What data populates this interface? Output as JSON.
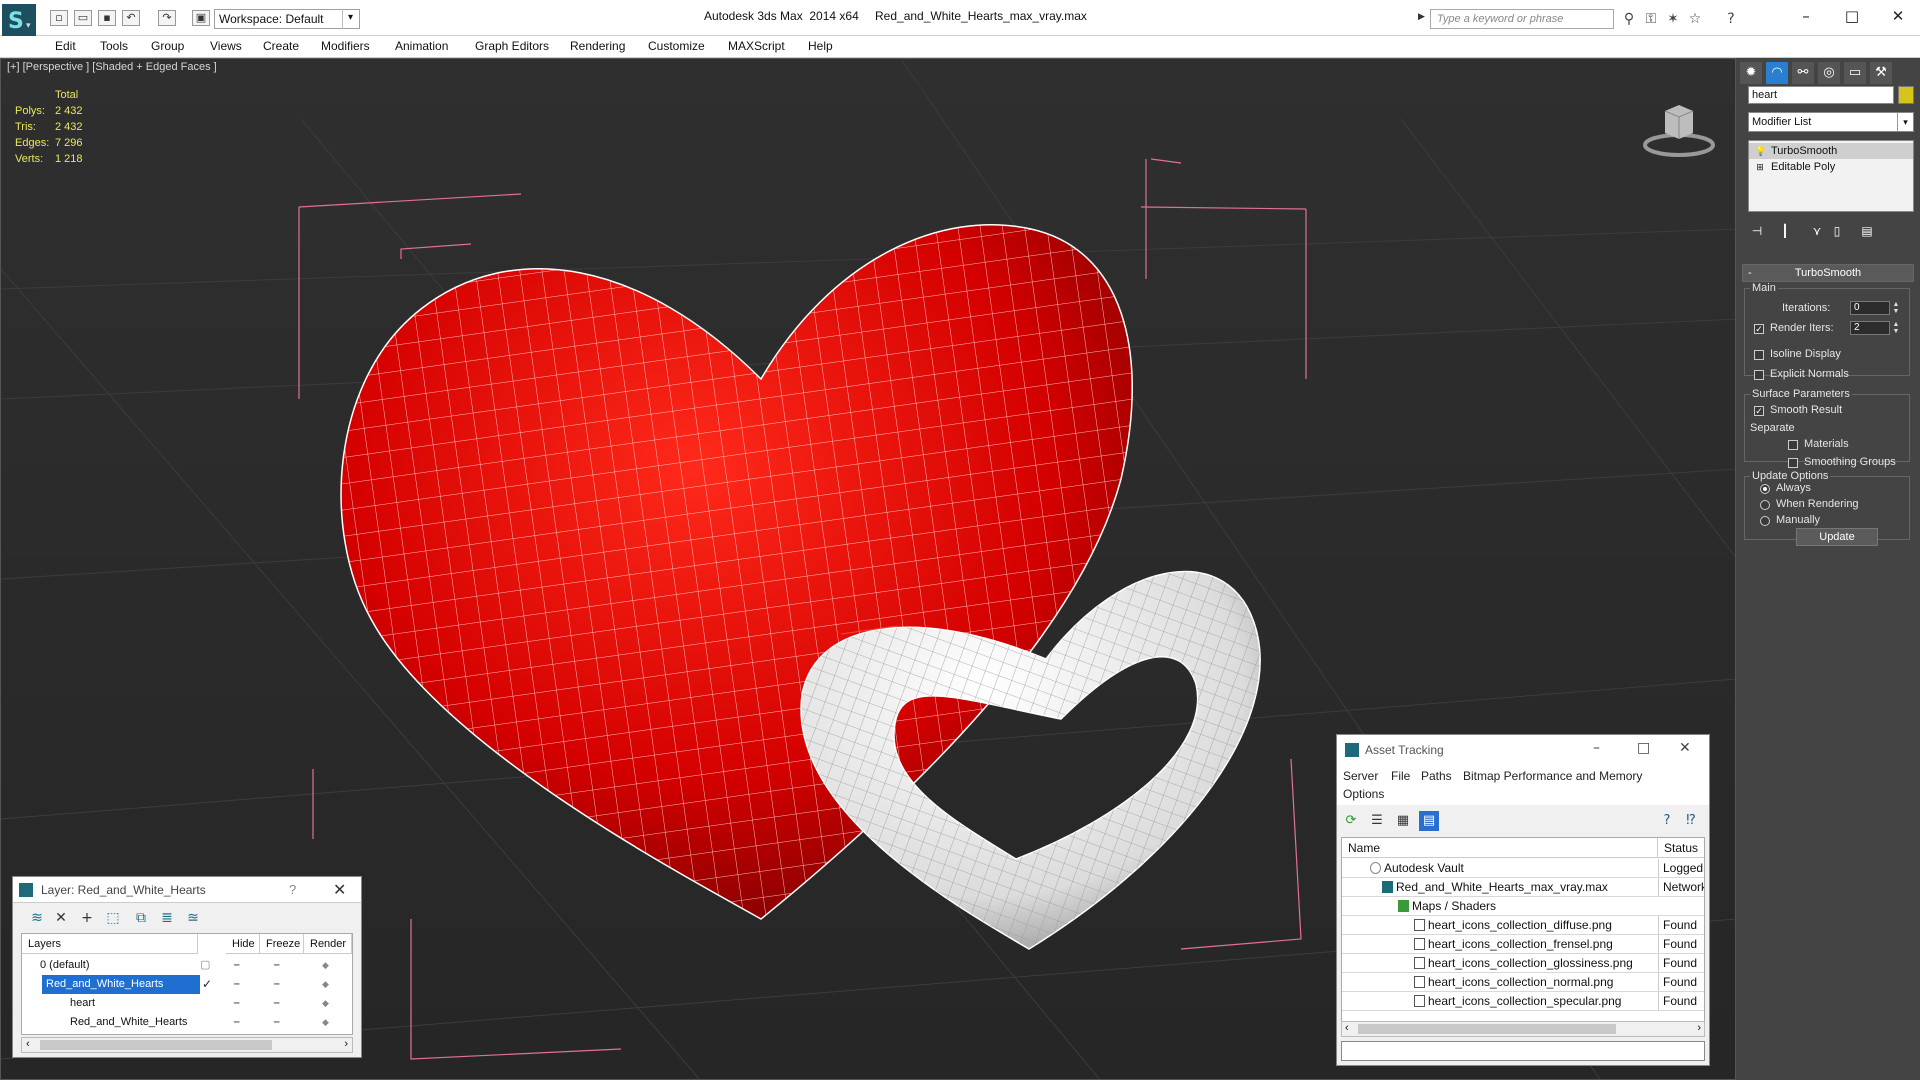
{
  "title_bar": {
    "app_title": "Autodesk 3ds Max  2014 x64",
    "file_title": "Red_and_White_Hearts_max_vray.max",
    "workspace": "Workspace: Default",
    "search_placeholder": "Type a keyword or phrase"
  },
  "menu": [
    "Edit",
    "Tools",
    "Group",
    "Views",
    "Create",
    "Modifiers",
    "Animation",
    "Graph Editors",
    "Rendering",
    "Customize",
    "MAXScript",
    "Help"
  ],
  "viewport": {
    "label": "[+] [Perspective ] [Shaded + Edged Faces ]",
    "stats": {
      "header": "Total",
      "rows": [
        {
          "key": "Polys:",
          "value": "2 432"
        },
        {
          "key": "Tris:",
          "value": "2 432"
        },
        {
          "key": "Edges:",
          "value": "7 296"
        },
        {
          "key": "Verts:",
          "value": "1 218"
        }
      ]
    }
  },
  "command_panel": {
    "object_name": "heart",
    "object_color": "#d6c41c",
    "modifier_list": "Modifier List",
    "stack": [
      "TurboSmooth",
      "Editable Poly"
    ],
    "rollout_title": "TurboSmooth",
    "main_group": "Main",
    "iterations_label": "Iterations:",
    "iterations_value": "0",
    "render_iters_label": "Render Iters:",
    "render_iters_value": "2",
    "isoline_display": "Isoline Display",
    "explicit_normals": "Explicit Normals",
    "surface_group": "Surface Parameters",
    "smooth_result": "Smooth Result",
    "separate": "Separate",
    "materials": "Materials",
    "smoothing_groups": "Smoothing Groups",
    "update_group": "Update Options",
    "always": "Always",
    "when_rendering": "When Rendering",
    "manually": "Manually",
    "update_button": "Update"
  },
  "layer_window": {
    "title": "Layer: Red_and_White_Hearts",
    "help": "?",
    "columns": [
      "Layers",
      "Hide",
      "Freeze",
      "Render"
    ],
    "rows": [
      "0 (default)",
      "Red_and_White_Hearts",
      "heart",
      "Red_and_White_Hearts"
    ]
  },
  "asset_window": {
    "title": "Asset Tracking",
    "menu": [
      "Server",
      "File",
      "Paths",
      "Bitmap Performance and Memory",
      "Options"
    ],
    "columns": [
      "Name",
      "Status"
    ],
    "rows": [
      {
        "name": "Autodesk Vault",
        "status": "Logged O"
      },
      {
        "name": "Red_and_White_Hearts_max_vray.max",
        "status": "Network"
      },
      {
        "name": "Maps / Shaders",
        "status": ""
      },
      {
        "name": "heart_icons_collection_diffuse.png",
        "status": "Found"
      },
      {
        "name": "heart_icons_collection_frensel.png",
        "status": "Found"
      },
      {
        "name": "heart_icons_collection_glossiness.png",
        "status": "Found"
      },
      {
        "name": "heart_icons_collection_normal.png",
        "status": "Found"
      },
      {
        "name": "heart_icons_collection_specular.png",
        "status": "Found"
      }
    ]
  },
  "colors": {
    "viewport_bg": "#2b2b2b",
    "stats_text": "#e8e85a",
    "red_heart": "#d60000",
    "white_heart": "#e8e8e8",
    "selection": "#1f6fd1",
    "bbox_pink": "#e0709a"
  }
}
